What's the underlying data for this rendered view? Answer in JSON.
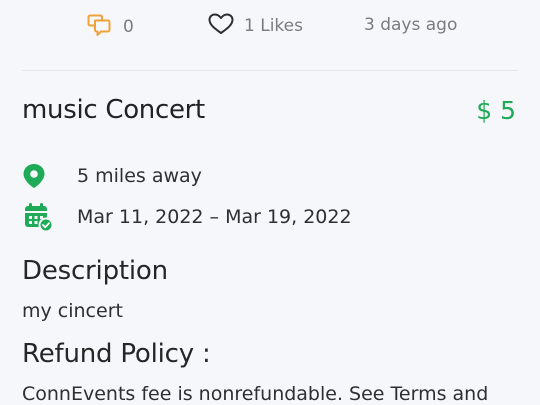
{
  "stats": {
    "comments_count": "0",
    "likes_label": "1 Likes",
    "posted_ago": "3 days ago"
  },
  "event": {
    "title": "music Concert",
    "price": "$ 5",
    "distance": "5 miles away",
    "date_range": "Mar 11, 2022 – Mar 19, 2022"
  },
  "description": {
    "heading": "Description",
    "text": "my cincert"
  },
  "refund": {
    "heading": "Refund Policy :",
    "text": "ConnEvents fee is nonrefundable. See Terms and"
  },
  "icons": {
    "comment": "comment-icon",
    "like": "heart-icon",
    "location": "location-pin-icon",
    "calendar": "calendar-check-icon"
  },
  "colors": {
    "accent_green": "#1faa57",
    "comment_orange": "#f0a23a",
    "muted_text": "#7b7b80"
  }
}
